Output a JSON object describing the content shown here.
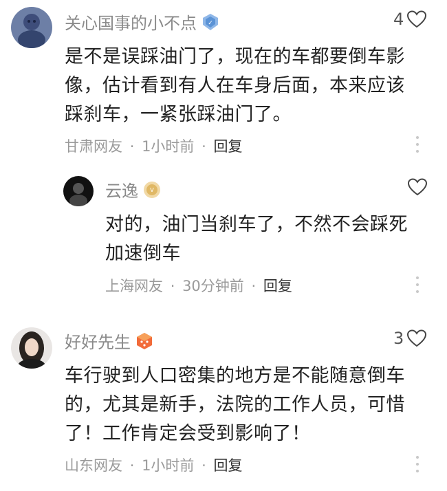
{
  "comments": [
    {
      "user": "关心国事的小不点",
      "likes": "4",
      "text": "是不是误踩油门了，现在的车都要倒车影像，估计看到有人在车身后面，本来应该踩刹车，一紧张踩油门了。",
      "lines": [
        "是不是误踩油门了，现在的车都要倒车影",
        "像，估计看到有人在车身后面，本来应该",
        "踩刹车，一紧张踩油门了。"
      ],
      "location": "甘肃网友",
      "time": "1小时前",
      "reply_label": "回复",
      "badge_icon": "verified-shield-icon"
    },
    {
      "user": "云逸",
      "likes": "",
      "lines": [
        "对的，油门当刹车了，不然不会踩死",
        "加速倒车"
      ],
      "location": "上海网友",
      "time": "30分钟前",
      "reply_label": "回复",
      "badge_icon": "level-badge-icon"
    },
    {
      "user": "好好先生",
      "likes": "3",
      "lines": [
        "车行驶到人口密集的地方是不能随意倒车",
        "的，尤其是新手，法院的工作人员，可惜",
        "了！工作肯定会受到影响了！"
      ],
      "location": "山东网友",
      "time": "1小时前",
      "reply_label": "回复",
      "badge_icon": "gift-badge-icon"
    }
  ],
  "separator": "·",
  "colors": {
    "name": "#8a8a8a",
    "text": "#222222",
    "meta": "#9a9a9a"
  }
}
